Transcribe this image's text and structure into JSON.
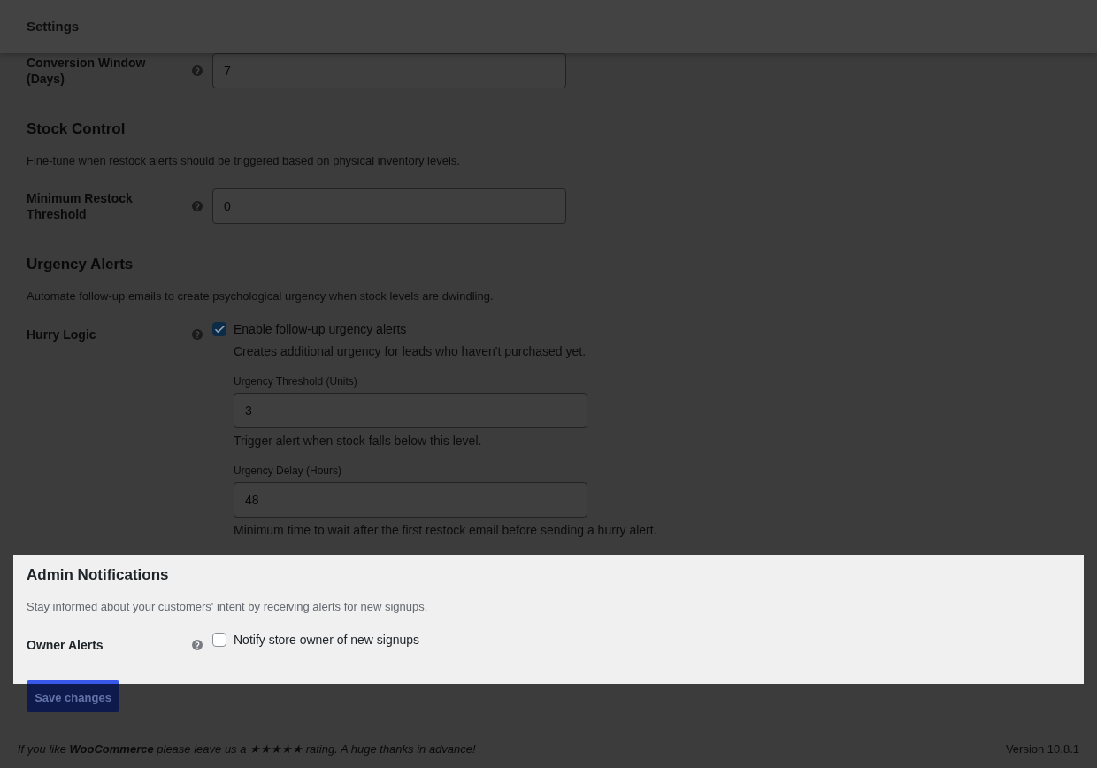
{
  "header": {
    "title": "Settings"
  },
  "sections": [
    {
      "spotlighted": false,
      "fields": [
        {
          "kind": "number",
          "label": "Conversion Window (Days)",
          "value": "7"
        }
      ]
    },
    {
      "spotlighted": false,
      "heading": "Stock Control",
      "description": "Fine-tune when restock alerts should be triggered based on physical inventory levels.",
      "fields": [
        {
          "kind": "number",
          "label": "Minimum Restock Threshold",
          "value": "0"
        }
      ]
    },
    {
      "spotlighted": false,
      "heading": "Urgency Alerts",
      "description": "Automate follow-up emails to create psychological urgency when stock levels are dwindling.",
      "fields": [
        {
          "kind": "checkbox",
          "label": "Hurry Logic",
          "option": "Enable follow-up urgency alerts",
          "checked": true,
          "description": "Creates additional urgency for leads who haven't purchased yet.",
          "subfields": [
            {
              "label": "Urgency Threshold (Units)",
              "value": "3",
              "help": "Trigger alert when stock falls below this level."
            },
            {
              "label": "Urgency Delay (Hours)",
              "value": "48",
              "help": "Minimum time to wait after the first restock email before sending a hurry alert."
            }
          ]
        }
      ]
    },
    {
      "spotlighted": true,
      "heading": "Admin Notifications",
      "description": "Stay informed about your customers' intent by receiving alerts for new signups.",
      "fields": [
        {
          "kind": "checkbox",
          "label": "Owner Alerts",
          "option": "Notify store owner of new signups",
          "checked": false
        }
      ]
    }
  ],
  "save_button": {
    "label": "Save changes"
  },
  "footer": {
    "text_before": "If you like **WooCommerce** please leave us a",
    "rating_link": "★★★★★",
    "text_after": "rating. A huge thanks in advance!",
    "version": "Version 10.8.1"
  }
}
